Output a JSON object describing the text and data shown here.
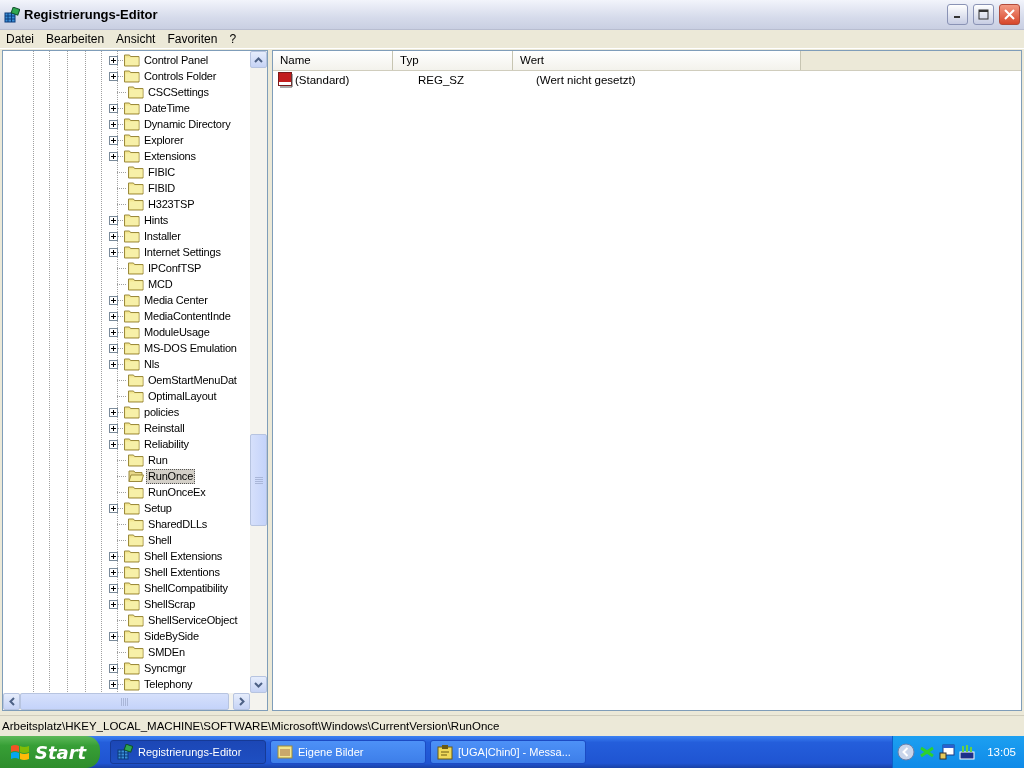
{
  "window": {
    "title": "Registrierungs-Editor"
  },
  "menu": [
    "Datei",
    "Bearbeiten",
    "Ansicht",
    "Favoriten",
    "?"
  ],
  "tree": {
    "items": [
      {
        "label": "Control Panel",
        "expandable": true,
        "selected": false
      },
      {
        "label": "Controls Folder",
        "expandable": true,
        "selected": false
      },
      {
        "label": "CSCSettings",
        "expandable": false,
        "selected": false
      },
      {
        "label": "DateTime",
        "expandable": true,
        "selected": false
      },
      {
        "label": "Dynamic Directory",
        "expandable": true,
        "selected": false
      },
      {
        "label": "Explorer",
        "expandable": true,
        "selected": false
      },
      {
        "label": "Extensions",
        "expandable": true,
        "selected": false
      },
      {
        "label": "FIBIC",
        "expandable": false,
        "selected": false
      },
      {
        "label": "FIBID",
        "expandable": false,
        "selected": false
      },
      {
        "label": "H323TSP",
        "expandable": false,
        "selected": false
      },
      {
        "label": "Hints",
        "expandable": true,
        "selected": false
      },
      {
        "label": "Installer",
        "expandable": true,
        "selected": false
      },
      {
        "label": "Internet Settings",
        "expandable": true,
        "selected": false
      },
      {
        "label": "IPConfTSP",
        "expandable": false,
        "selected": false
      },
      {
        "label": "MCD",
        "expandable": false,
        "selected": false
      },
      {
        "label": "Media Center",
        "expandable": true,
        "selected": false
      },
      {
        "label": "MediaContentInde",
        "expandable": true,
        "selected": false
      },
      {
        "label": "ModuleUsage",
        "expandable": true,
        "selected": false
      },
      {
        "label": "MS-DOS Emulation",
        "expandable": true,
        "selected": false
      },
      {
        "label": "Nls",
        "expandable": true,
        "selected": false
      },
      {
        "label": "OemStartMenuDat",
        "expandable": false,
        "selected": false
      },
      {
        "label": "OptimalLayout",
        "expandable": false,
        "selected": false
      },
      {
        "label": "policies",
        "expandable": true,
        "selected": false
      },
      {
        "label": "Reinstall",
        "expandable": true,
        "selected": false
      },
      {
        "label": "Reliability",
        "expandable": true,
        "selected": false
      },
      {
        "label": "Run",
        "expandable": false,
        "selected": false
      },
      {
        "label": "RunOnce",
        "expandable": false,
        "selected": true
      },
      {
        "label": "RunOnceEx",
        "expandable": false,
        "selected": false
      },
      {
        "label": "Setup",
        "expandable": true,
        "selected": false
      },
      {
        "label": "SharedDLLs",
        "expandable": false,
        "selected": false
      },
      {
        "label": "Shell",
        "expandable": false,
        "selected": false
      },
      {
        "label": "Shell Extensions",
        "expandable": true,
        "selected": false
      },
      {
        "label": "Shell Extentions",
        "expandable": true,
        "selected": false
      },
      {
        "label": "ShellCompatibility",
        "expandable": true,
        "selected": false
      },
      {
        "label": "ShellScrap",
        "expandable": true,
        "selected": false
      },
      {
        "label": "ShellServiceObject",
        "expandable": false,
        "selected": false
      },
      {
        "label": "SideBySide",
        "expandable": true,
        "selected": false
      },
      {
        "label": "SMDEn",
        "expandable": false,
        "selected": false
      },
      {
        "label": "Syncmgr",
        "expandable": true,
        "selected": false
      },
      {
        "label": "Telephony",
        "expandable": true,
        "selected": false
      }
    ]
  },
  "list": {
    "columns": [
      "Name",
      "Typ",
      "Wert"
    ],
    "rows": [
      {
        "name": "(Standard)",
        "type": "REG_SZ",
        "value": "(Wert nicht gesetzt)"
      }
    ]
  },
  "status_bar": "Arbeitsplatz\\HKEY_LOCAL_MACHINE\\SOFTWARE\\Microsoft\\Windows\\CurrentVersion\\RunOnce",
  "taskbar": {
    "start": "Start",
    "tasks": [
      {
        "label": "Registrierungs-Editor",
        "kind": "regedit",
        "selected": true
      },
      {
        "label": "Eigene Bilder",
        "kind": "folder",
        "selected": false
      },
      {
        "label": "[UGA|Chin0] - Messa...",
        "kind": "messenger",
        "selected": false
      }
    ],
    "clock": "13:05"
  }
}
